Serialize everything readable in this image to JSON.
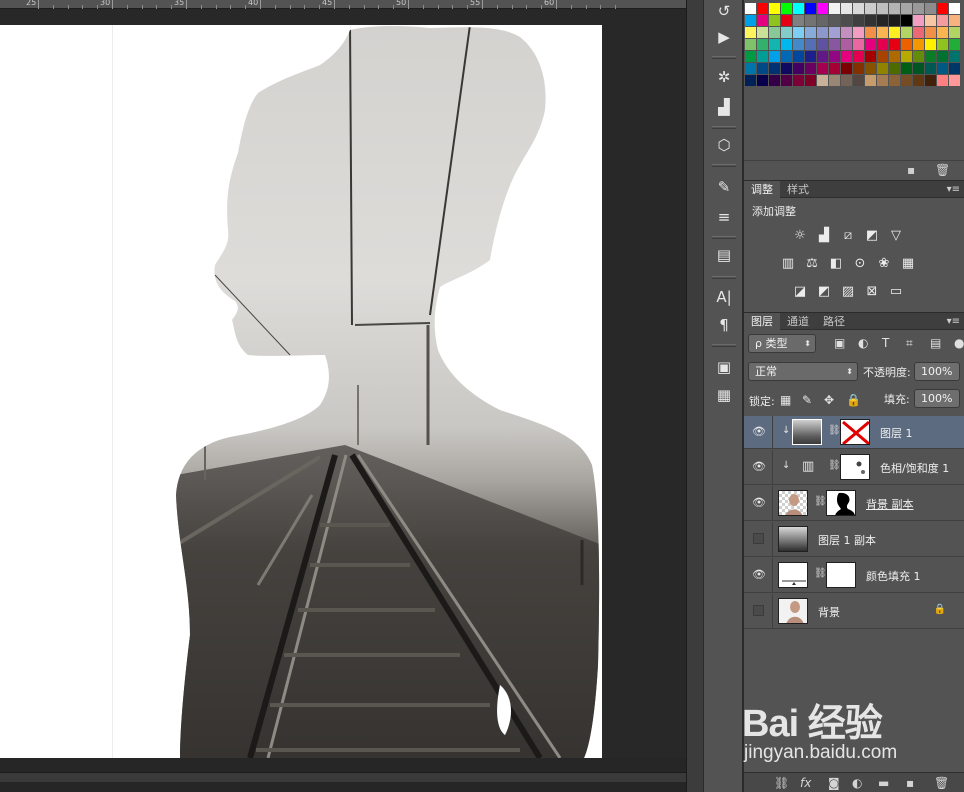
{
  "ruler": {
    "labels": [
      "25",
      "30",
      "35",
      "40",
      "45",
      "50",
      "55",
      "60"
    ]
  },
  "swatches": {
    "colors": [
      "#ffffff",
      "#ff0000",
      "#ffff00",
      "#00ff00",
      "#00ffff",
      "#0000ff",
      "#ff00ff",
      "#f2f2f2",
      "#e6e6e6",
      "#d9d9d9",
      "#cccccc",
      "#bfbfbf",
      "#b3b3b3",
      "#a6a6a6",
      "#999999",
      "#8c8c8c",
      "#ff0000",
      "#ffffff",
      "#00a0e9",
      "#e4007f",
      "#8fc31f",
      "#e60012",
      "#808080",
      "#737373",
      "#666666",
      "#595959",
      "#4d4d4d",
      "#404040",
      "#333333",
      "#262626",
      "#1a1a1a",
      "#000000",
      "#f19ec2",
      "#f7c6a3",
      "#f29c9f",
      "#f6b37f",
      "#fff45c",
      "#cce198",
      "#89c997",
      "#84ccc9",
      "#7ecef4",
      "#88abda",
      "#8c97cb",
      "#a3a0d5",
      "#c490bf",
      "#f19ec2",
      "#f19149",
      "#f8b551",
      "#fcee21",
      "#b3d465",
      "#eb6877",
      "#f19149",
      "#f8b551",
      "#b3d465",
      "#80c269",
      "#32b16c",
      "#13b5b1",
      "#00b7ee",
      "#448aca",
      "#556fb5",
      "#5f52a0",
      "#8957a1",
      "#ae5da1",
      "#ea68a2",
      "#e4007f",
      "#e5004f",
      "#e60012",
      "#eb6100",
      "#f39800",
      "#fff100",
      "#8fc31f",
      "#22ac38",
      "#009944",
      "#009e96",
      "#00a0e9",
      "#0068b7",
      "#00479d",
      "#1d2088",
      "#601986",
      "#920783",
      "#e4007f",
      "#e5004f",
      "#a40000",
      "#a84200",
      "#ac6a00",
      "#b7aa00",
      "#638c0b",
      "#097c25",
      "#007130",
      "#00736d",
      "#0075a9",
      "#004986",
      "#003271",
      "#100964",
      "#440062",
      "#6a005f",
      "#a4004f",
      "#a40035",
      "#7d0000",
      "#833100",
      "#855200",
      "#8f8300",
      "#4e6b00",
      "#005e15",
      "#005623",
      "#005853",
      "#005983",
      "#003567",
      "#002157",
      "#09004c",
      "#330047",
      "#520045",
      "#7e0038",
      "#7e0026",
      "#c7b299",
      "#998675",
      "#736357",
      "#534741",
      "#c69c6d",
      "#a67c52",
      "#8c6239",
      "#754c24",
      "#603913",
      "#42210b",
      "#ff8080",
      "#ff9999"
    ]
  },
  "adjust_panel": {
    "tabs": [
      "调整",
      "样式"
    ],
    "title": "添加调整",
    "rows": [
      [
        "brightness-icon",
        "levels-icon",
        "curves-icon",
        "exposure-icon",
        "vibrance-icon"
      ],
      [
        "hue-saturation-icon",
        "color-balance-icon",
        "black-white-icon",
        "photo-filter-icon",
        "channel-mixer-icon",
        "color-lookup-icon"
      ],
      [
        "invert-icon",
        "posterize-icon",
        "threshold-icon",
        "selective-color-icon",
        "gradient-map-icon"
      ]
    ]
  },
  "layers_panel": {
    "tabs": [
      "图层",
      "通道",
      "路径"
    ],
    "filter_label": "ρ 类型",
    "blend_mode": "正常",
    "opacity_label": "不透明度:",
    "opacity_value": "100%",
    "lock_label": "锁定:",
    "fill_label": "填充:",
    "fill_value": "100%",
    "layers": [
      {
        "name": "图层 1",
        "visible": true,
        "selected": true,
        "clipped": true,
        "thumb": "fog",
        "mask": "disabled",
        "underlined": false,
        "locked": false
      },
      {
        "name": "色相/饱和度 1",
        "visible": true,
        "selected": false,
        "clipped": true,
        "thumb": "adjustment",
        "mask": "dots",
        "underlined": false,
        "locked": false
      },
      {
        "name": "背景 副本",
        "visible": true,
        "selected": false,
        "clipped": false,
        "thumb": "person-transparent",
        "mask": "silhouette",
        "underlined": true,
        "locked": false
      },
      {
        "name": "图层 1 副本",
        "visible": false,
        "selected": false,
        "clipped": false,
        "thumb": "fog",
        "mask": null,
        "underlined": false,
        "locked": false
      },
      {
        "name": "颜色填充 1",
        "visible": true,
        "selected": false,
        "clipped": false,
        "thumb": "fill",
        "mask": "white",
        "underlined": false,
        "locked": false
      },
      {
        "name": "背景",
        "visible": false,
        "selected": false,
        "clipped": false,
        "thumb": "person",
        "mask": null,
        "underlined": false,
        "locked": true
      }
    ]
  },
  "watermark": {
    "logo": "Bai 经验",
    "url": "jingyan.baidu.com"
  }
}
